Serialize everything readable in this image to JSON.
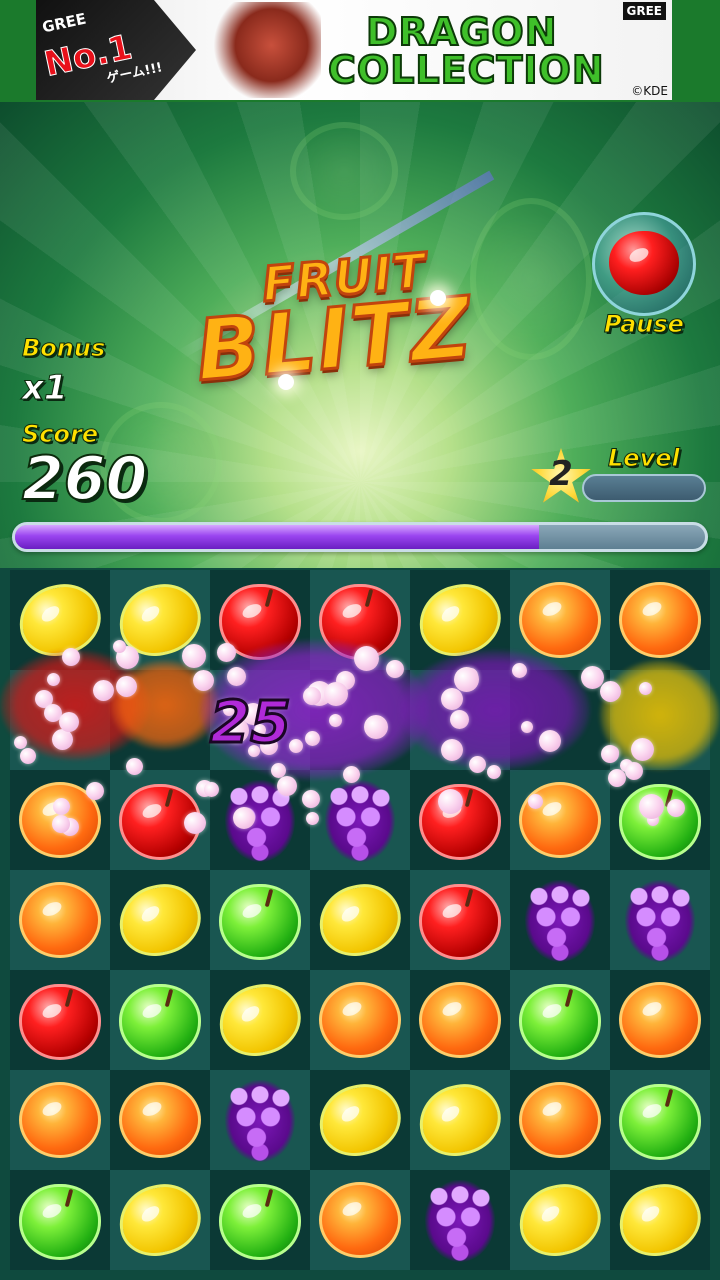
{
  "ad": {
    "badge_top": "GREE",
    "badge_main": "No.1",
    "badge_sub": "ゲーム!!!",
    "title_line1": "DRAGON",
    "title_line2": "COLLECTION",
    "publisher": "GREE",
    "copyright": "©KDE"
  },
  "logo": {
    "line1": "FRUIT",
    "line2": "BLITZ"
  },
  "hud": {
    "bonus_label": "Bonus",
    "bonus_value": "x1",
    "score_label": "Score",
    "score_value": "260",
    "level_label": "Level",
    "level_value": "2",
    "level_progress": 0.0,
    "time_remaining": 0.76,
    "pause_label": "Pause"
  },
  "popup": {
    "points": "25"
  },
  "colors": {
    "label_yellow": "#ffe000",
    "time_bar_fill": "#9b45f0",
    "board_bg": "#0f4a45"
  },
  "board": {
    "rows": [
      [
        "lemon",
        "lemon",
        "apple-red",
        "apple-red",
        "lemon",
        "orange",
        "orange"
      ],
      [
        "splash",
        "splash",
        "splash",
        "splash",
        "splash",
        "splash",
        "splash"
      ],
      [
        "orange",
        "apple-red",
        "grape",
        "grape",
        "apple-red",
        "orange",
        "apple-green"
      ],
      [
        "orange",
        "lemon",
        "apple-green",
        "lemon",
        "apple-red",
        "grape",
        "grape"
      ],
      [
        "apple-red",
        "apple-green",
        "lemon",
        "orange",
        "orange",
        "apple-green",
        "orange"
      ],
      [
        "orange",
        "orange",
        "grape",
        "lemon",
        "lemon",
        "orange",
        "apple-green"
      ],
      [
        "apple-green",
        "lemon",
        "apple-green",
        "orange",
        "grape",
        "lemon",
        "lemon"
      ]
    ]
  }
}
